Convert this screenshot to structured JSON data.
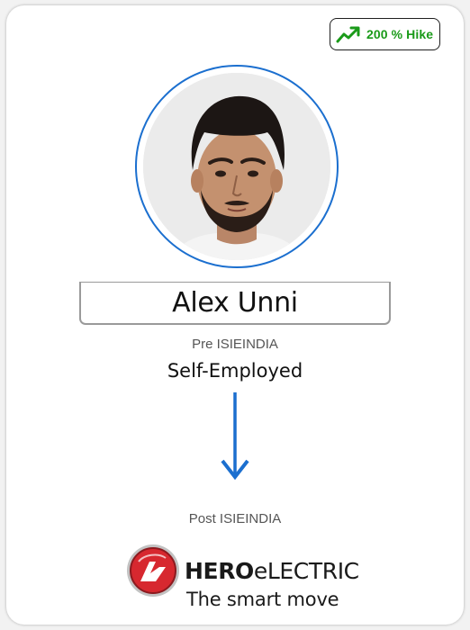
{
  "badge": {
    "label": "200 % Hike",
    "icon": "trend-up-icon",
    "color": "#1a9a19"
  },
  "profile": {
    "name": "Alex Unni",
    "ring_color": "#1b6fcf"
  },
  "pre": {
    "label": "Pre ISIEINDIA",
    "value": "Self-Employed"
  },
  "transition": {
    "icon": "arrow-down-icon",
    "color": "#1b6fcf"
  },
  "post": {
    "label": "Post ISIEINDIA",
    "company": {
      "brand_bold": "HERO",
      "brand_light": "eLECTRIC",
      "tagline": "The smart move",
      "accent_color": "#d7282f"
    }
  }
}
